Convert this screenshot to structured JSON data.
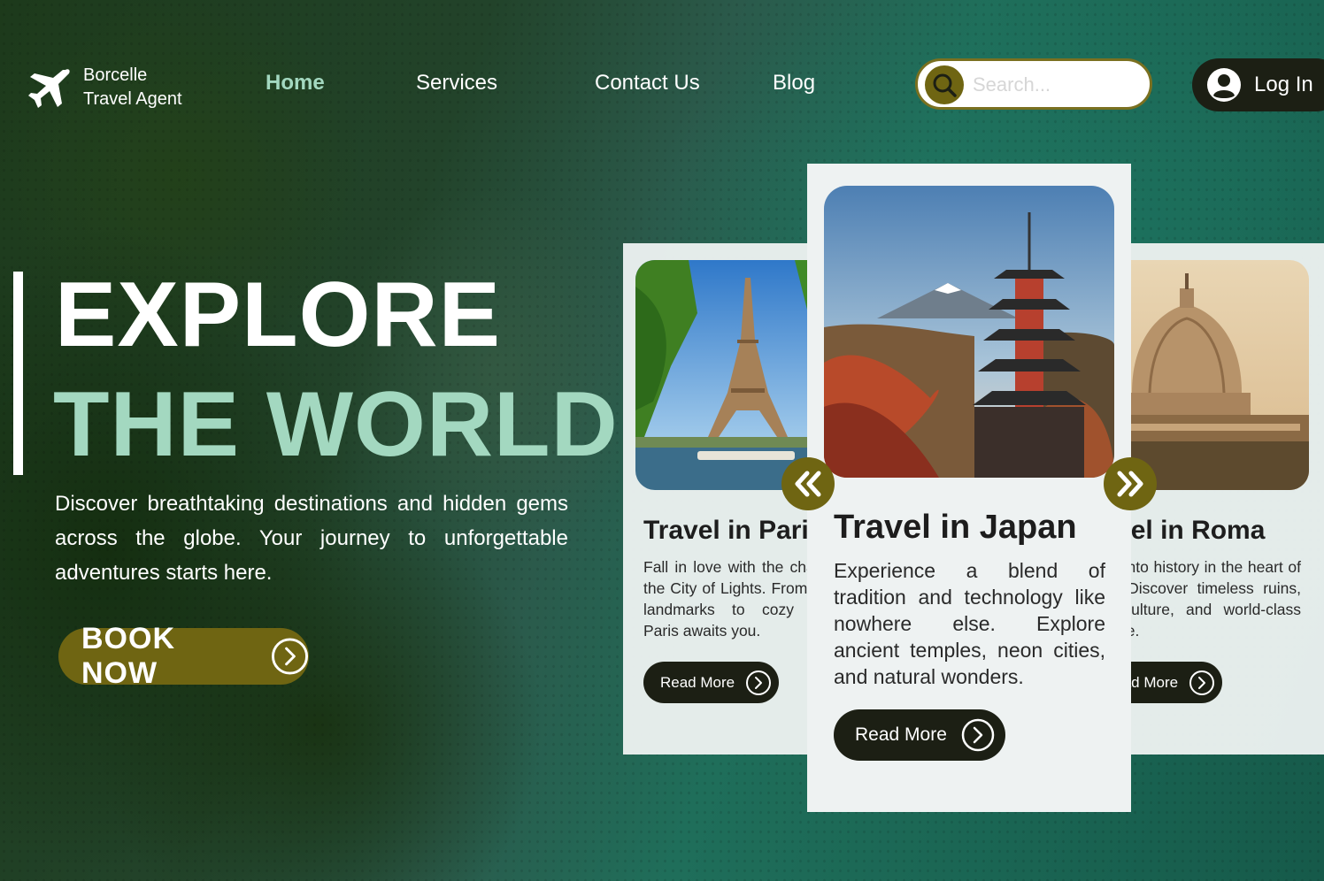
{
  "brand": {
    "line1": "Borcelle",
    "line2": "Travel Agent",
    "icon": "airplane-icon"
  },
  "nav": [
    {
      "label": "Home",
      "active": true
    },
    {
      "label": "Services",
      "active": false
    },
    {
      "label": "Contact Us",
      "active": false
    },
    {
      "label": "Blog",
      "active": false
    }
  ],
  "search": {
    "placeholder": "Search...",
    "value": "",
    "icon": "search-icon"
  },
  "login": {
    "label": "Log In",
    "icon": "user-avatar-icon"
  },
  "hero": {
    "line1": "EXPLORE",
    "line2": "THE WORLD",
    "description": "Discover breathtaking destinations and hidden gems across the globe. Your journey to unforgettable adventures starts here.",
    "cta": "BOOK NOW"
  },
  "cards": {
    "paris": {
      "title": "Travel in Paris",
      "text": "Fall in love with the charm of the City of Lights. From iconic landmarks to cozy cafés, Paris awaits you.",
      "button": "Read More",
      "image": "eiffel-tower-photo"
    },
    "japan": {
      "title": "Travel in Japan",
      "text": "Experience a blend of tradition and technology like nowhere else. Explore ancient temples, neon cities, and natural wonders.",
      "button": "Read More",
      "image": "pagoda-photo"
    },
    "roma": {
      "title": "Travel in Roma",
      "text": "Step into history in the heart of Italy. Discover timeless ruins, rich culture, and world-class cuisine.",
      "button": "Read More",
      "image": "st-peters-dome-photo"
    }
  },
  "carousel": {
    "prev_icon": "double-chevron-left-icon",
    "next_icon": "double-chevron-right-icon"
  },
  "colors": {
    "olive": "#6f6512",
    "mint": "#a3d8c0",
    "dark": "#1c1f14",
    "card": "#eef2f2"
  }
}
